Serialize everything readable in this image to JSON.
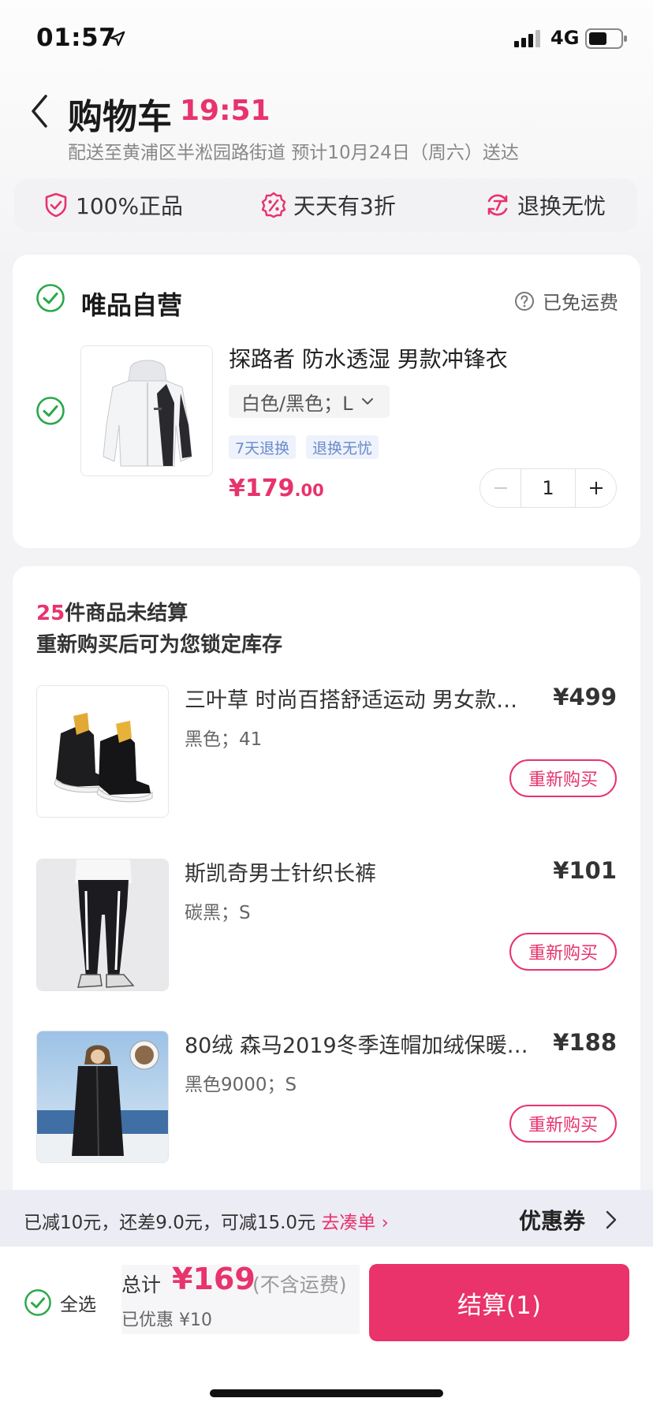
{
  "status_bar": {
    "time": "01:57",
    "network": "4G"
  },
  "header": {
    "title": "购物车",
    "countdown": "19:51",
    "delivery": "配送至黄浦区半淞园路街道   预计10月24日（周六）送达"
  },
  "guarantees": [
    {
      "label": "100%正品",
      "icon": "shield-check-icon"
    },
    {
      "label": "天天有3折",
      "icon": "discount-icon"
    },
    {
      "label": "退换无忧",
      "icon": "return-7-icon"
    }
  ],
  "store": {
    "name": "唯品自营",
    "shipping": "已免运费",
    "item": {
      "title": "探路者  防水透湿 男款冲锋衣",
      "sku": "白色/黑色；L",
      "tags": [
        "7天退换",
        "退换无忧"
      ],
      "price_main": "¥179",
      "price_decimal": ".00",
      "quantity": "1"
    }
  },
  "unsettled": {
    "count": "25",
    "count_suffix": "件商品未结算",
    "note": "重新购买后可为您锁定库存",
    "rebuy_label": "重新购买",
    "items": [
      {
        "title": "三叶草 时尚百搭舒适运动 男女款…",
        "price": "¥499",
        "sku": "黑色；41"
      },
      {
        "title": "斯凯奇男士针织长裤",
        "price": "¥101",
        "sku": "碳黑；S"
      },
      {
        "title": "80绒 森马2019冬季连帽加绒保暖…",
        "price": "¥188",
        "sku": "黑色9000；S"
      }
    ]
  },
  "promo": {
    "text": "已减10元，还差9.0元，可减15.0元",
    "link": "去凑单 ›",
    "coupon": "优惠券"
  },
  "footer": {
    "select_all": "全选",
    "total_label": "总计",
    "total_amount": "¥169",
    "total_note": "(不含运费)",
    "saved": "已优惠 ¥10",
    "checkout": "结算(1)"
  },
  "colors": {
    "accent": "#e8336d",
    "check_green": "#2aa84a",
    "tag_blue": "#6b8ac8"
  }
}
